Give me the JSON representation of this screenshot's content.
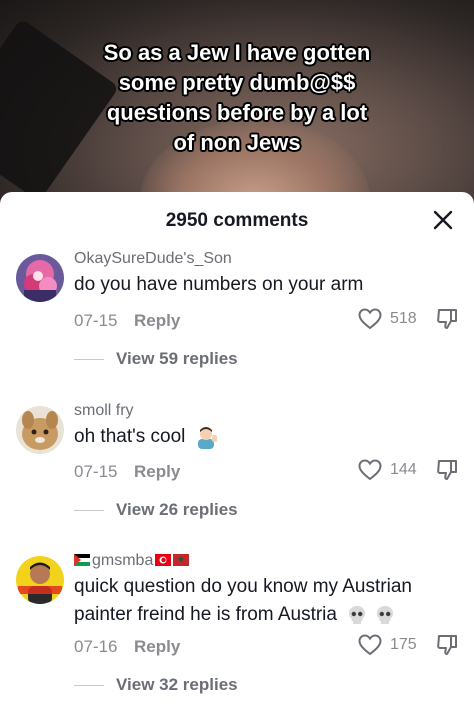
{
  "video": {
    "caption_lines": [
      "So as a Jew I have gotten",
      "some pretty dumb@$$",
      "questions before by a lot",
      "of non Jews"
    ]
  },
  "sheet": {
    "title": "2950 comments",
    "close_icon": "close-icon"
  },
  "comments": [
    {
      "username": "OkaySureDude's_Son",
      "text": "do you have numbers on your arm",
      "date": "07-15",
      "reply_label": "Reply",
      "likes": "518",
      "view_replies": "View 59 replies"
    },
    {
      "username": "smoll fry",
      "text": "oh that's cool",
      "text_emoji": "man-tipping-hand-emoji",
      "date": "07-15",
      "reply_label": "Reply",
      "likes": "144",
      "view_replies": "View 26 replies"
    },
    {
      "username": "gmsmba",
      "username_flags": [
        "palestine-flag",
        "tunisia-flag",
        "morocco-flag"
      ],
      "text": "quick question do you know my Austrian painter freind he is from Austria",
      "text_emoji": "skull-emoji skull-emoji",
      "date": "07-16",
      "reply_label": "Reply",
      "likes": "175",
      "view_replies": "View 32 replies"
    }
  ],
  "colors": {
    "primary_text": "#161823",
    "secondary_text": "#8a8b91"
  }
}
